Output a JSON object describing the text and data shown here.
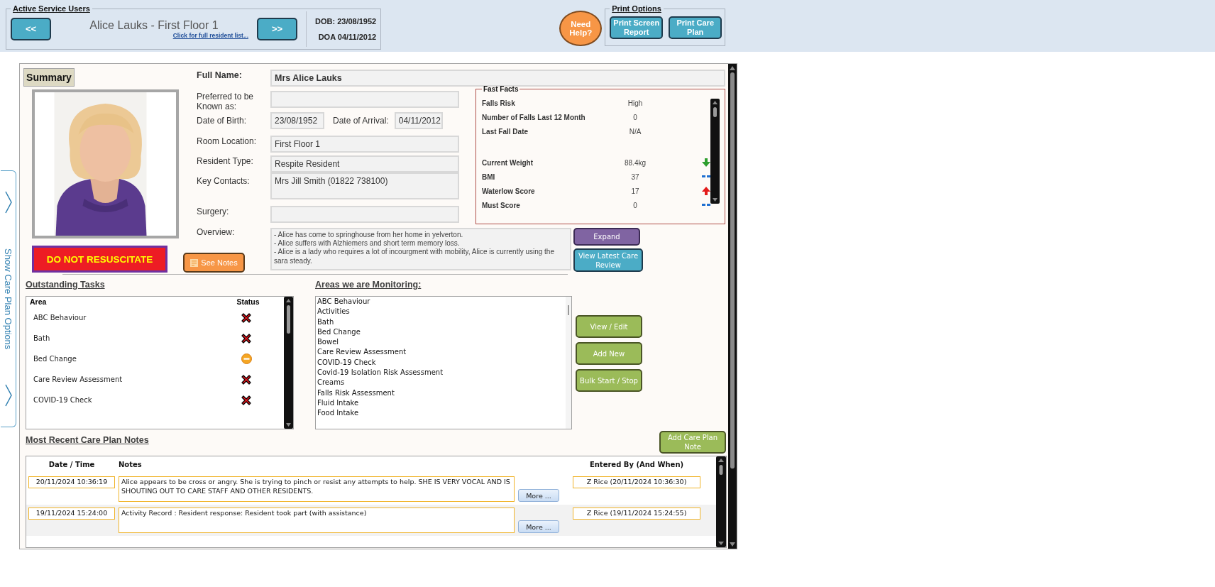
{
  "header": {
    "group_title": "Active Service Users",
    "prev_button": "<<",
    "resident": "Alice Lauks - First Floor 1",
    "resident_list_link": "Click for full resident list...",
    "next_button": ">>",
    "dob": "DOB: 23/08/1952",
    "doa": "DOA 04/11/2012",
    "help_button": "Need Help?",
    "print_title": "Print Options",
    "print_buttons": [
      "Print Screen Report",
      "Print Care Plan"
    ]
  },
  "side_tab": {
    "label": "Show Care Plan Options"
  },
  "summary": {
    "tab": "Summary",
    "photo": {
      "kind": "picture"
    },
    "alert": "DO NOT RESUSCITATE",
    "notes_button": "See Notes",
    "full_name": {
      "label": "Full Name:",
      "value": "Mrs Alice Lauks"
    },
    "fields": [
      {
        "kind": "text",
        "label": "Preferred to be Known as:"
      },
      {
        "kind": "date_pair",
        "label": "Date of Birth:",
        "value": "23/08/1952",
        "label_2": "Date of Arrival:",
        "value_2": "04/11/2012"
      },
      {
        "kind": "text",
        "label": "Room Location:",
        "value": "First Floor 1"
      },
      {
        "kind": "text",
        "label": "Resident Type:",
        "value": "Respite Resident"
      },
      {
        "kind": "memo",
        "label": "Key Contacts:",
        "value": "Mrs Jill Smith (01822 738100)"
      },
      {
        "kind": "text",
        "label": "Surgery:"
      }
    ],
    "overview": {
      "label": "Overview:",
      "lines": [
        "- Alice has come to springhouse from her home in yelverton.",
        "- Alice suffers with Alzhiemers and short term memory loss.",
        "- Alice is a lady who requires a lot of incourgment with mobility, Alice is currently using the sara steady."
      ]
    },
    "buttons": [
      "Expand",
      "View Latest Care Review"
    ]
  },
  "fast_facts": {
    "title": "Fast Facts",
    "groups": [
      [
        {
          "label": "Falls Risk",
          "value": "High",
          "kind": "plain"
        },
        {
          "label": "Number of Falls Last 12 Month",
          "value": "0",
          "kind": "plain"
        },
        {
          "label": "Last Fall Date",
          "value": "N/A",
          "kind": "plain"
        }
      ],
      [
        {
          "label": "Current Weight",
          "value": "88.4kg",
          "kind": "falling"
        },
        {
          "label": "BMI",
          "value": "37",
          "kind": "steady"
        },
        {
          "label": "Waterlow Score",
          "value": "17",
          "kind": "rising"
        },
        {
          "label": "Must Score",
          "value": "0",
          "kind": "steady"
        }
      ]
    ]
  },
  "tasks": {
    "heading": "Outstanding Tasks",
    "columns": [
      "Area",
      "Status"
    ],
    "rows": [
      {
        "area": "ABC Behaviour",
        "kind": "overdue"
      },
      {
        "area": "Bath",
        "kind": "overdue"
      },
      {
        "area": "Bed Change",
        "kind": "due"
      },
      {
        "area": "Care Review Assessment",
        "kind": "overdue"
      },
      {
        "area": "COVID-19 Check",
        "kind": "overdue"
      }
    ]
  },
  "monitoring": {
    "heading": "Areas we are Monitoring:",
    "items": [
      "ABC Behaviour",
      "Activities",
      "Bath",
      "Bed Change",
      "Bowel",
      "Care Review Assessment",
      "COVID-19 Check",
      "Covid-19 Isolation Risk Assessment",
      "Creams",
      "Falls Risk Assessment",
      "Fluid Intake",
      "Food Intake"
    ],
    "buttons": [
      "View / Edit",
      "Add New",
      "Bulk Start / Stop"
    ]
  },
  "notes": {
    "heading": "Most Recent Care Plan Notes",
    "add_button": "Add Care Plan Note",
    "columns": [
      "Date / Time",
      "Notes",
      "Entered By (And When)"
    ],
    "rows": [
      {
        "date": "20/11/2024 10:36:19",
        "note": "Alice appears to be cross or angry. She is trying to pinch or resist any attempts to help. SHE IS VERY VOCAL AND IS SHOUTING OUT TO CARE STAFF AND OTHER RESIDENTS.",
        "more": "More ...",
        "entered": "Z Rice (20/11/2024 10:36:30)"
      },
      {
        "date": "19/11/2024 15:24:00",
        "note": "Activity Record : Resident response: Resident took part (with assistance)",
        "more": "More ...",
        "entered": "Z Rice (19/11/2024 15:24:55)"
      }
    ]
  }
}
